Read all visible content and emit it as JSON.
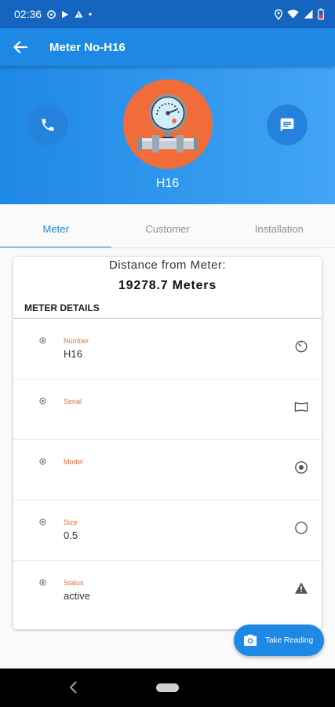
{
  "status_bar": {
    "time": "02:36"
  },
  "app_bar": {
    "title": "Meter No-H16"
  },
  "header": {
    "meter_name": "H16",
    "colors": {
      "gradient_start": "#1e88e5",
      "gradient_end": "#42a5f5",
      "avatar": "#f26c3a"
    }
  },
  "tabs": [
    {
      "label": "Meter",
      "active": true
    },
    {
      "label": "Customer",
      "active": false
    },
    {
      "label": "Installation",
      "active": false
    }
  ],
  "card": {
    "distance_label": "Distance from Meter:",
    "distance_value": "19278.7 Meters",
    "section_title": "METER DETAILS",
    "fields": [
      {
        "label": "Number",
        "value": "H16",
        "icon": "timer-icon"
      },
      {
        "label": "Serial",
        "value": "",
        "icon": "panorama-icon"
      },
      {
        "label": "Model",
        "value": "",
        "icon": "radio-button-icon"
      },
      {
        "label": "Size",
        "value": "0.5",
        "icon": "circle-outline-icon"
      },
      {
        "label": "Status",
        "value": "active",
        "icon": "warning-icon"
      }
    ]
  },
  "fab": {
    "label": "Take Reading",
    "icon": "camera-icon"
  },
  "icons": [
    "back-arrow-icon",
    "phone-icon",
    "message-icon",
    "pressure-gauge-icon",
    "location-icon",
    "wifi-icon",
    "signal-icon",
    "battery-icon"
  ]
}
